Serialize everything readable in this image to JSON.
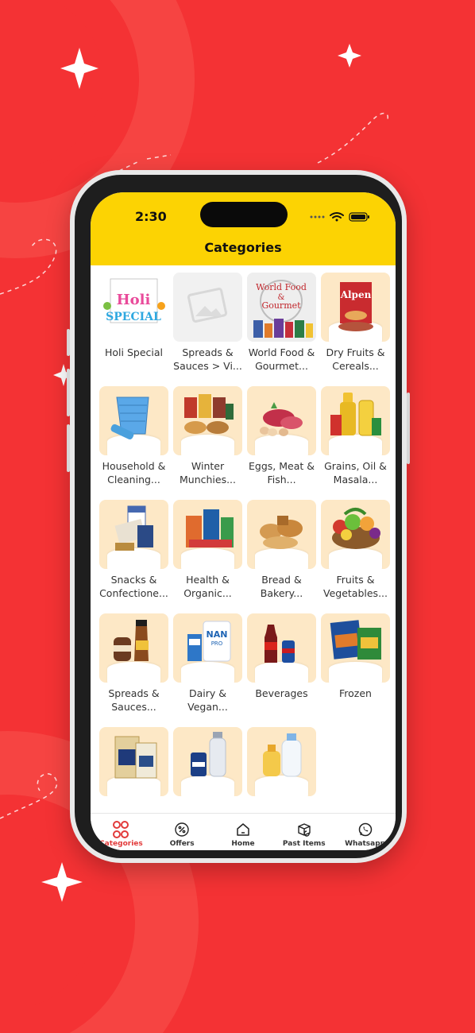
{
  "status_bar": {
    "time": "2:30"
  },
  "header": {
    "title": "Categories"
  },
  "categories": [
    {
      "label": "Holi Special",
      "tile": "holi"
    },
    {
      "label": "Spreads & Sauces > Vi...",
      "tile": "placeholder"
    },
    {
      "label": "World Food & Gourmet...",
      "tile": "world",
      "image_text": "World Food & Gourmet"
    },
    {
      "label": "Dry Fruits & Cereals...",
      "tile": "cereal",
      "image_text": "Alpen"
    },
    {
      "label": "Household & Cleaning...",
      "tile": "household"
    },
    {
      "label": "Winter Munchies...",
      "tile": "winter"
    },
    {
      "label": "Eggs, Meat & Fish...",
      "tile": "meat"
    },
    {
      "label": "Grains, Oil & Masala...",
      "tile": "grains"
    },
    {
      "label": "Snacks & Confectione...",
      "tile": "snacks"
    },
    {
      "label": "Health & Organic...",
      "tile": "health"
    },
    {
      "label": "Bread & Bakery...",
      "tile": "bread"
    },
    {
      "label": "Fruits & Vegetables...",
      "tile": "fruits"
    },
    {
      "label": "Spreads & Sauces...",
      "tile": "spreads"
    },
    {
      "label": "Dairy & Vegan...",
      "tile": "dairy",
      "image_text": "NAN PRO"
    },
    {
      "label": "Beverages",
      "tile": "beverages"
    },
    {
      "label": "Frozen",
      "tile": "frozen"
    },
    {
      "label": "",
      "tile": "rice"
    },
    {
      "label": "",
      "tile": "personal"
    },
    {
      "label": "",
      "tile": "baby"
    }
  ],
  "tabbar": {
    "items": [
      {
        "label": "Categories",
        "icon": "categories-grid-icon",
        "active": true
      },
      {
        "label": "Offers",
        "icon": "percent-badge-icon"
      },
      {
        "label": "Home",
        "icon": "home-icon"
      },
      {
        "label": "Past Items",
        "icon": "box-refresh-icon"
      },
      {
        "label": "Whatsapp",
        "icon": "whatsapp-icon"
      }
    ]
  },
  "colors": {
    "background": "#f43234",
    "header": "#fcd303",
    "tile": "#fde8c6",
    "active_tab": "#e23a3a"
  }
}
